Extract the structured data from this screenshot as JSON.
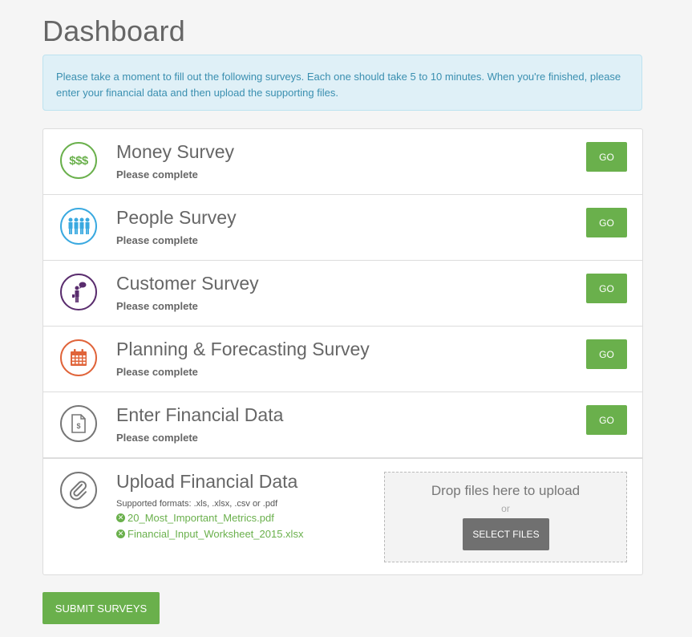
{
  "page": {
    "title": "Dashboard"
  },
  "alert": {
    "text": "Please take a moment to fill out the following surveys. Each one should take 5 to 10 minutes. When you're finished, please enter your financial data and then upload the supporting files."
  },
  "rows": [
    {
      "title": "Money Survey",
      "status": "Please complete",
      "go_label": "GO",
      "icon": "money-icon",
      "icon_text": "$$$",
      "color": "#6ab04c"
    },
    {
      "title": "People Survey",
      "status": "Please complete",
      "go_label": "GO",
      "icon": "people-icon",
      "color": "#3aa9e0"
    },
    {
      "title": "Customer Survey",
      "status": "Please complete",
      "go_label": "GO",
      "icon": "customer-icon",
      "color": "#5a2d6e"
    },
    {
      "title": "Planning & Forecasting Survey",
      "status": "Please complete",
      "go_label": "GO",
      "icon": "calendar-icon",
      "color": "#e0643a"
    },
    {
      "title": "Enter Financial Data",
      "status": "Please complete",
      "go_label": "GO",
      "icon": "document-dollar-icon",
      "icon_text": "$",
      "color": "#777777"
    }
  ],
  "upload": {
    "title": "Upload Financial Data",
    "formats": "Supported formats: .xls, .xlsx, .csv or .pdf",
    "icon": "paperclip-icon",
    "icon_color": "#777777",
    "files": [
      {
        "name": "20_Most_Important_Metrics.pdf"
      },
      {
        "name": "Financial_Input_Worksheet_2015.xlsx"
      }
    ],
    "dropzone": {
      "text": "Drop files here to upload",
      "or": "or",
      "button": "SELECT FILES"
    }
  },
  "submit": {
    "label": "SUBMIT SURVEYS"
  },
  "colors": {
    "accent_green": "#6ab04c",
    "alert_bg": "#dff0f7",
    "alert_text": "#3a8fb0"
  }
}
